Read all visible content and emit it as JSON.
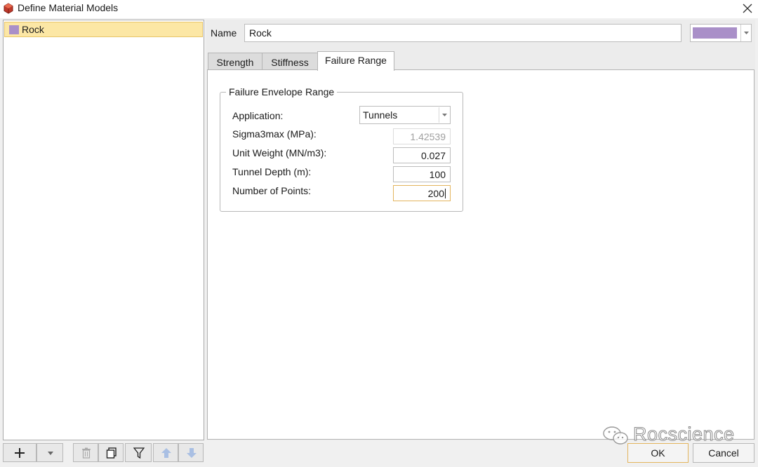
{
  "window": {
    "title": "Define Material Models"
  },
  "materials": [
    {
      "label": "Rock",
      "color": "#a98fc8"
    }
  ],
  "name_field": {
    "label": "Name",
    "value": "Rock",
    "color": "#a98fc8"
  },
  "tabs": [
    {
      "label": "Strength",
      "active": false
    },
    {
      "label": "Stiffness",
      "active": false
    },
    {
      "label": "Failure Range",
      "active": true
    }
  ],
  "failure_range": {
    "group_title": "Failure Envelope Range",
    "application": {
      "label": "Application:",
      "value": "Tunnels"
    },
    "sigma3max": {
      "label": "Sigma3max (MPa):",
      "value": "1.42539",
      "disabled": true
    },
    "unit_weight": {
      "label": "Unit Weight (MN/m3):",
      "value": "0.027"
    },
    "tunnel_depth": {
      "label": "Tunnel Depth (m):",
      "value": "100"
    },
    "num_points": {
      "label": "Number of Points:",
      "value": "200",
      "focused": true
    }
  },
  "toolbar": {
    "buttons": [
      "plus-icon",
      "dropdown-arrow-icon",
      "trash-icon",
      "copy-icon",
      "filter-icon",
      "arrow-up-icon",
      "arrow-down-icon"
    ]
  },
  "watermark": {
    "text": "Rocscience"
  },
  "dialog_buttons": {
    "ok": "OK",
    "cancel": "Cancel"
  }
}
